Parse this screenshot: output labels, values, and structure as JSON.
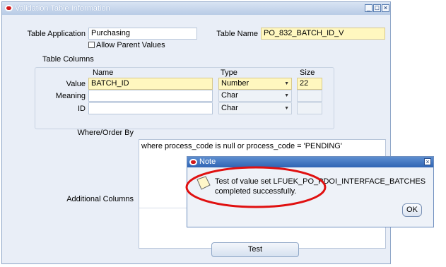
{
  "window": {
    "title": "Validation Table Information",
    "controls": [
      "minimize-icon",
      "maximize-icon",
      "close-icon"
    ]
  },
  "form": {
    "table_application": {
      "label": "Table Application",
      "value": "Purchasing"
    },
    "allow_parent_values": {
      "label": "Allow Parent Values",
      "checked": false
    },
    "table_name": {
      "label": "Table Name",
      "value": "PO_832_BATCH_ID_V"
    },
    "table_columns": {
      "group_label": "Table Columns",
      "headers": {
        "name": "Name",
        "type": "Type",
        "size": "Size"
      },
      "rows": [
        {
          "label": "Value",
          "name": "BATCH_ID",
          "type": "Number",
          "size": "22"
        },
        {
          "label": "Meaning",
          "name": "",
          "type": "Char",
          "size": ""
        },
        {
          "label": "ID",
          "name": "",
          "type": "Char",
          "size": ""
        }
      ]
    },
    "where_order_by": {
      "label": "Where/Order By",
      "value": "where process_code is null or process_code = 'PENDING'"
    },
    "additional_columns": {
      "label": "Additional Columns"
    },
    "test_button": "Test"
  },
  "note": {
    "title": "Note",
    "message": "Test of value set LFUEK_PO_PDOI_INTERFACE_BATCHES completed successfully.",
    "ok_button": "OK",
    "highlight_color": "#e01010"
  },
  "colors": {
    "window_body": "#e9eef7",
    "title_active": "#2f64b4",
    "required_field": "#fff7bf"
  }
}
